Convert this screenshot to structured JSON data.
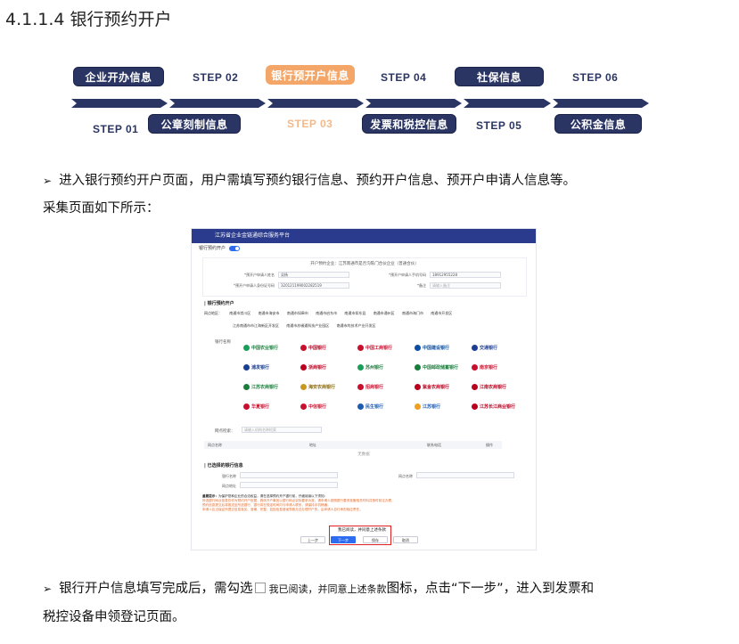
{
  "heading": "4.1.1.4 银行预约开户",
  "flow": {
    "top_pills": [
      "企业开办信息",
      "银行预开户信息",
      "社保信息"
    ],
    "top_steps": [
      "STEP 02",
      "STEP 04",
      "STEP 06"
    ],
    "bottom_steps": [
      "STEP 01",
      "STEP 03",
      "STEP 05"
    ],
    "bottom_pills": [
      "公章刻制信息",
      "发票和税控信息",
      "公积金信息"
    ],
    "colors": {
      "dark": "#2b3563",
      "active": "#f4a668"
    }
  },
  "para1": {
    "bullet": "➢",
    "line1": "进入银行预约开户页面，用户需填写预约银行信息、预约开户信息、预开户申请人信息等。",
    "line2": "采集页面如下所示："
  },
  "shot": {
    "title": "江苏省企业金链通综合服务平台",
    "sub_label": "银行预约开户",
    "card_title": "开户预约企业：江苏南通市是否沟陈门合伙企业（普通合伙）",
    "f1_label": "*预开户申请人姓名",
    "f1_value": "吴杨",
    "f2_label": "*预开户申请人手机号码",
    "f2_value": "18912955228",
    "f3_label": "*预开户申请人身份证号码",
    "f3_value": "320121199002282519",
    "f4_label": "*备注",
    "f4_placeholder": "请输入备注",
    "section1": "| 银行预约开户",
    "region_label": "网点地区：",
    "regions_row1": [
      "南通市崇川区",
      "南通市海安市",
      "南通市如皋市",
      "南通市启东市",
      "南通市如东县",
      "南通市通州区",
      "南通市海门市",
      "南通市开发区"
    ],
    "regions_row2": [
      "江苏南通市市江海新区开发区",
      "南通市苏锡通科技产业园区",
      "南通市的技术产业开发区"
    ],
    "bank_label": "银行名称",
    "banks": [
      "中国农业银行",
      "中国银行",
      "中国工商银行",
      "中国建设银行",
      "交通银行",
      "浦发银行",
      "浙商银行",
      "苏州银行",
      "中国邮政储蓄银行",
      "南京银行",
      "江苏农商银行",
      "海安农商银行",
      "招商银行",
      "紫金农商银行",
      "江南农商银行",
      "华夏银行",
      "中信银行",
      "民生银行",
      "江苏银行",
      "江苏长江商业银行"
    ],
    "search_label": "网点检索：",
    "search_placeholder": "请输入机构名称检索",
    "table_cols": [
      "网点名称",
      "地址",
      "联系电话",
      "操作"
    ],
    "table_empty": "无数据",
    "section2": "| 已选择的银行信息",
    "sel_bank_label": "银行名称",
    "sel_branch_label": "网点名称",
    "sel_addr_label": "网点地址",
    "notice_title": "重要提示：",
    "notice_lines": [
      "为保护您和企业的合法权益，请在选择预约开户银行前，仔细阅读以下须知：",
      "所选银行网点信息仅作为预约开户依据，具体开户事宜以银行网点实际要求为准，请申请人按照银行要求准备相关材料并按时前往办理。",
      "预约信息提交后将推送至所选银行，银行将在规定时间内与申请人联系，请保持手机畅通。",
      "申请人应当保证所提交信息真实、准确、完整，如因信息错误导致无法办理开户的，由申请人自行承担相应责任。"
    ],
    "agree_text": "我已阅读，并同意上述条款",
    "btn_prev": "上一步",
    "btn_next": "下一步",
    "btn_save": "保存",
    "btn_cancel": "取消"
  },
  "para2": {
    "bullet": "➢",
    "text_a": "银行开户信息填写完成后，需勾选",
    "inline_agree": "我已阅读，并同意上述条款",
    "text_b": "图标，点击“下一步”，进入到发票和",
    "line2": "税控设备申领登记页面。"
  }
}
